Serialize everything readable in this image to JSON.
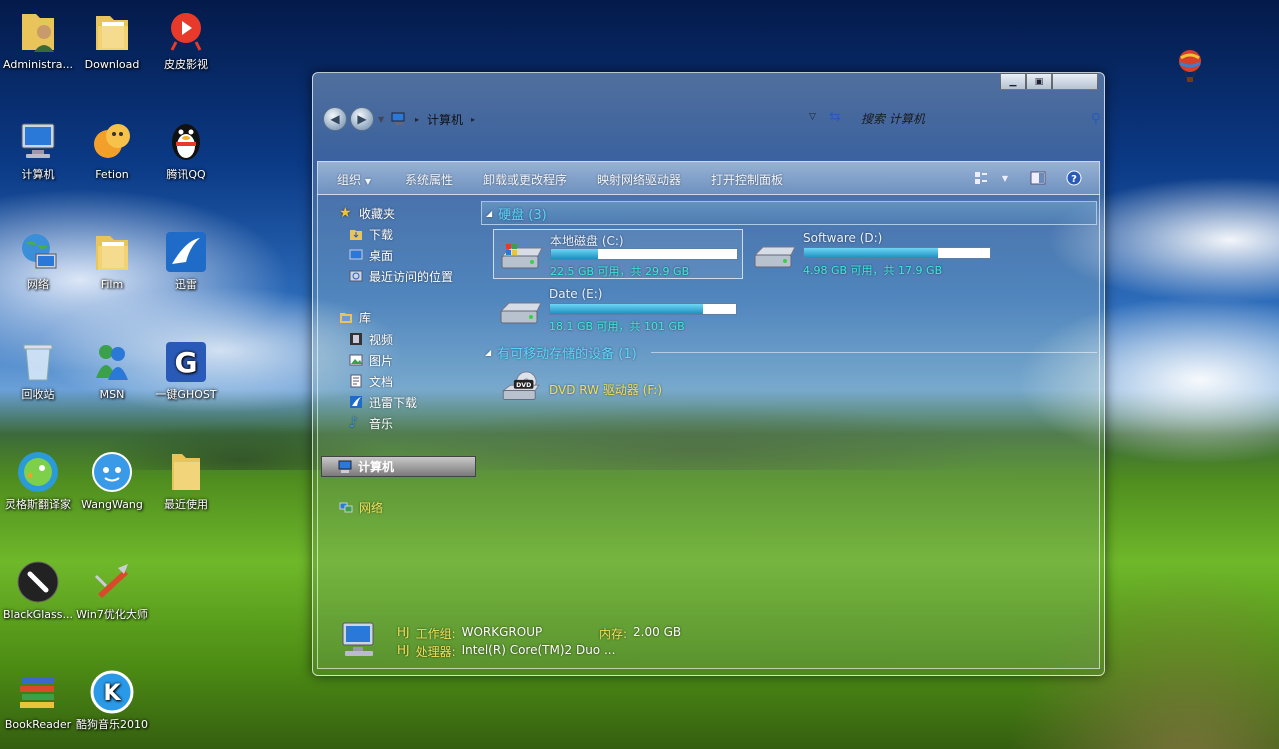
{
  "desktop": {
    "icons": [
      {
        "label": "Administra..."
      },
      {
        "label": "Download"
      },
      {
        "label": "皮皮影视"
      },
      {
        "label": "计算机"
      },
      {
        "label": "Fetion"
      },
      {
        "label": "腾讯QQ"
      },
      {
        "label": "网络"
      },
      {
        "label": "Film"
      },
      {
        "label": "迅雷"
      },
      {
        "label": "回收站"
      },
      {
        "label": "MSN"
      },
      {
        "label": "一键GHOST"
      },
      {
        "label": "灵格斯翻译家"
      },
      {
        "label": "WangWang"
      },
      {
        "label": "最近使用"
      },
      {
        "label": "BlackGlass..."
      },
      {
        "label": "Win7优化大师"
      },
      {
        "label": "BookReader"
      },
      {
        "label": "酷狗音乐2010"
      }
    ]
  },
  "window": {
    "address": "计算机",
    "search_placeholder": "搜索 计算机",
    "toolbar": {
      "organize": "组织",
      "system_properties": "系统属性",
      "uninstall": "卸载或更改程序",
      "map_drive": "映射网络驱动器",
      "control_panel": "打开控制面板"
    },
    "sidebar": {
      "favorites": "收藏夹",
      "download": "下载",
      "desktop": "桌面",
      "recent": "最近访问的位置",
      "libraries": "库",
      "videos": "视频",
      "pictures": "图片",
      "documents": "文档",
      "thunder_downloads": "迅雷下载",
      "music": "音乐",
      "computer": "计算机",
      "network": "网络"
    },
    "groups": {
      "hard_disks": "硬盘 (3)",
      "removable": "有可移动存储的设备 (1)"
    },
    "drives": [
      {
        "name": "本地磁盘 (C:)",
        "free_text": "22.5 GB 可用，共 29.9 GB",
        "used_fraction": 0.25
      },
      {
        "name": "Software (D:)",
        "free_text": "4.98 GB 可用，共 17.9 GB",
        "used_fraction": 0.72
      },
      {
        "name": "Date (E:)",
        "free_text": "18.1 GB 可用，共 101 GB",
        "used_fraction": 0.82
      }
    ],
    "dvd": {
      "name": "DVD RW 驱动器 (F:)",
      "icon_text": "DVD"
    },
    "details": {
      "name1": "HJ",
      "workgroup_label": "工作组:",
      "workgroup_value": "WORKGROUP",
      "memory_label": "内存:",
      "memory_value": "2.00 GB",
      "name2": "HJ",
      "cpu_label": "处理器:",
      "cpu_value": "Intel(R) Core(TM)2 Duo ..."
    }
  }
}
